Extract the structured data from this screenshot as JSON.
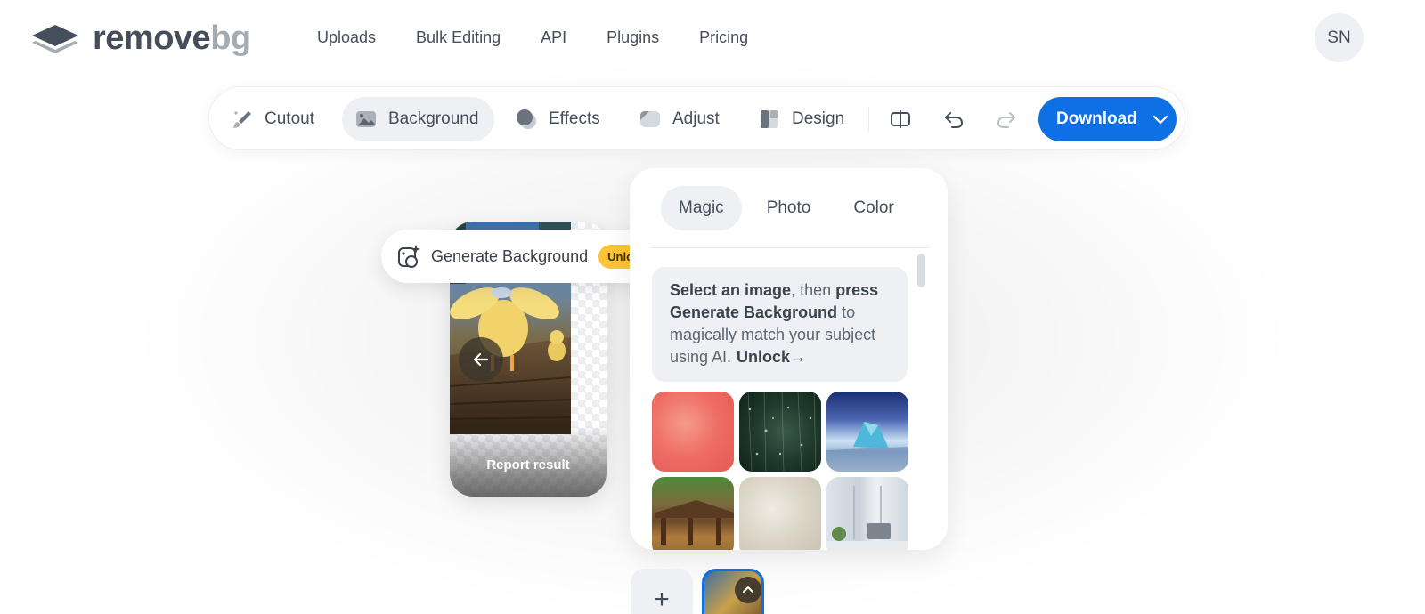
{
  "brand": {
    "name_main": "remove",
    "name_accent": "bg"
  },
  "nav": {
    "items": [
      "Uploads",
      "Bulk Editing",
      "API",
      "Plugins",
      "Pricing"
    ]
  },
  "user": {
    "initials": "SN"
  },
  "toolbar": {
    "tools": [
      {
        "label": "Cutout",
        "icon": "brush-icon"
      },
      {
        "label": "Background",
        "icon": "image-icon",
        "active": true
      },
      {
        "label": "Effects",
        "icon": "effects-icon"
      },
      {
        "label": "Adjust",
        "icon": "adjust-icon"
      },
      {
        "label": "Design",
        "icon": "design-icon"
      }
    ],
    "download_label": "Download"
  },
  "preview": {
    "report_label": "Report result",
    "generate_label": "Generate Background",
    "unlock_badge": "Unlock"
  },
  "panel": {
    "tabs": [
      "Magic",
      "Photo",
      "Color"
    ],
    "active_tab": "Magic",
    "info": {
      "part1": "Select an image",
      "part2": ", then ",
      "part3": "press Generate Background",
      "part4": " to magically match your subject using AI.",
      "link": "Unlock",
      "link_arrow": "→"
    }
  },
  "bottom": {
    "add_symbol": "+"
  },
  "colors": {
    "accent": "#0f70e6",
    "unlock": "#fdc435",
    "text": "#454f5b",
    "soft_bg": "#eef0f3"
  }
}
